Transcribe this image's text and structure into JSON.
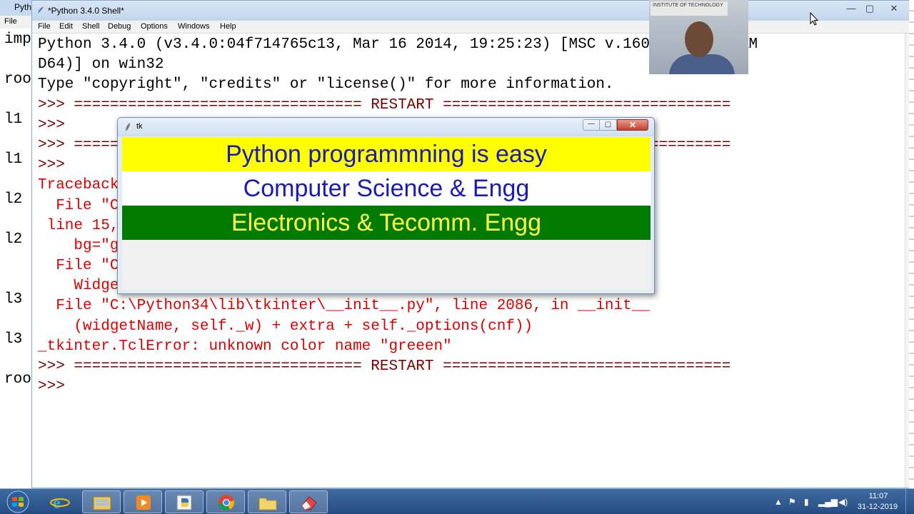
{
  "background_editor": {
    "title": "Pyth",
    "menu_file": "File",
    "code_fragments": [
      "imp",
      "roo",
      "l1",
      "l1",
      "l2",
      "l2",
      "l3",
      "l3",
      "roo"
    ]
  },
  "shell": {
    "title": "*Python 3.4.0 Shell*",
    "menu": [
      "File",
      "Edit",
      "Shell",
      "Debug",
      "Options",
      "Windows",
      "Help"
    ],
    "window_controls": {
      "minimize": "—",
      "maximize": "▢",
      "close": "✕"
    },
    "lines": [
      "Python 3.4.0 (v3.4.0:04f714765c13, Mar 16 2014, 19:25:23) [MSC v.1600 64 bit (AM",
      "D64)] on win32",
      "Type \"copyright\", \"credits\" or \"license()\" for more information.",
      ">>> ================================ RESTART ================================",
      ">>> ",
      ">>> ================================ RESTART ================================",
      ">>> ",
      "Traceback (most recent call last):",
      "  File \"C:/Users/Desktop/Python/Lecture/CHB of Python/gui2.py\",",
      " line 15, in <module>",
      "    bg=\"greeen\").pack(fill=X)",
      "  File \"C:\\Python34\\lib\\tkinter\\__init__.py\", line 2596, in __init__",
      "    Widget.__init__(self, master, 'label', cnf, kw)",
      "  File \"C:\\Python34\\lib\\tkinter\\__init__.py\", line 2086, in __init__",
      "    (widgetName, self._w) + extra + self._options(cnf))",
      "_tkinter.TclError: unknown color name \"greeen\"",
      ">>> ================================ RESTART ================================",
      ">>> "
    ],
    "line_styles": [
      "black",
      "black",
      "black",
      "dark",
      "dark",
      "dark",
      "dark",
      "red",
      "red",
      "red",
      "red",
      "red",
      "red",
      "red",
      "red",
      "red",
      "dark",
      "dark"
    ]
  },
  "tk_window": {
    "title": "tk",
    "labels": [
      {
        "text": "Python programmning is easy",
        "bg": "#ffff00",
        "fg": "#1a1ab8"
      },
      {
        "text": "Computer Science & Engg",
        "bg": "#ffffff",
        "fg": "#1a1ab8"
      },
      {
        "text": "Electronics & Tecomm. Engg",
        "bg": "#007a00",
        "fg": "#ffff44"
      }
    ],
    "controls": {
      "minimize": "—",
      "maximize": "▢",
      "close": "✕"
    }
  },
  "webcam": {
    "sign_text": "INSTITUTE OF TECHNOLOGY"
  },
  "taskbar": {
    "apps": [
      "internet-explorer",
      "file-explorer",
      "media-player",
      "python-idle",
      "chrome",
      "folder",
      "eraser-tool"
    ],
    "clock_time": "11:07",
    "clock_date": "31-12-2019"
  },
  "colors": {
    "traceback_red": "#dd0000",
    "prompt_dark": "#7a0000",
    "taskbar_blue": "#254d83"
  }
}
